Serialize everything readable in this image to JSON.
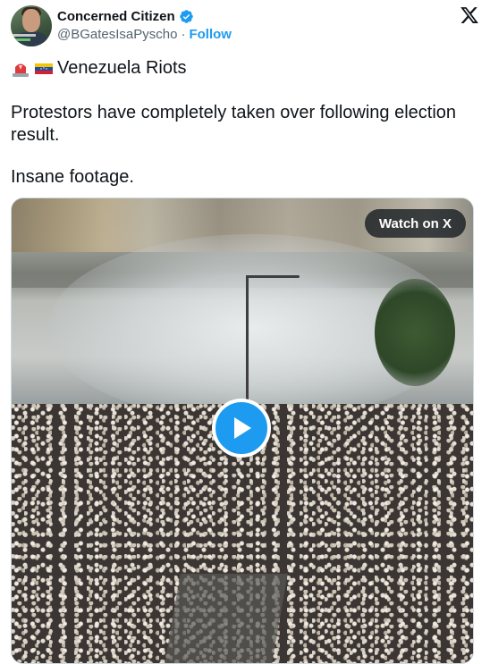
{
  "post": {
    "author": {
      "display_name": "Concerned Citizen",
      "handle": "@BGatesIsaPyscho",
      "separator": "·",
      "follow_label": "Follow",
      "verified_icon": "verified-badge-icon",
      "avatar_icon": "avatar"
    },
    "platform_logo": "x-logo-icon",
    "headline_text": "Venezuela Riots",
    "emojis": [
      "police-light-emoji",
      "venezuela-flag-emoji"
    ],
    "body_text": "Protestors have completely taken over following election result.",
    "footer_text": "Insane footage.",
    "media": {
      "type": "video",
      "watch_label": "Watch on X",
      "play_icon": "play-icon"
    }
  },
  "colors": {
    "accent": "#1d9bf0",
    "text": "#0f1419",
    "muted": "#536471"
  }
}
